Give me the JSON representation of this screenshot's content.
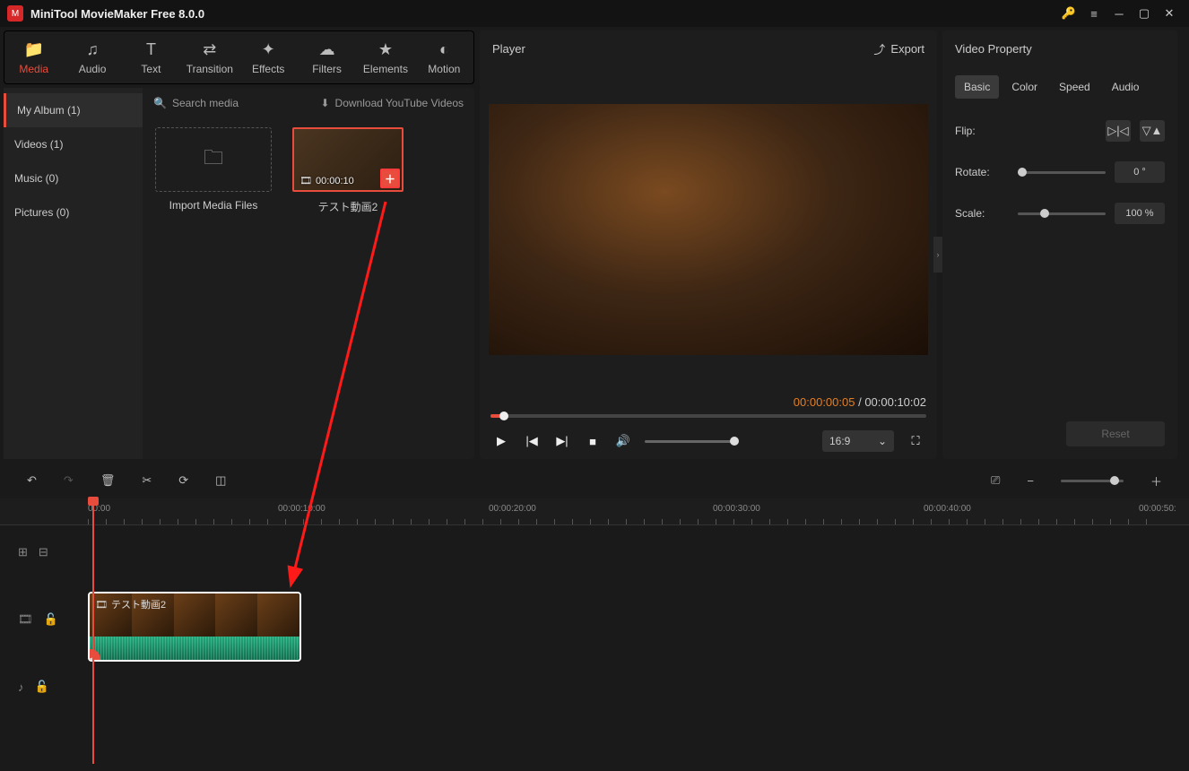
{
  "titlebar": {
    "app_title": "MiniTool MovieMaker Free 8.0.0"
  },
  "tabs": {
    "media": "Media",
    "audio": "Audio",
    "text": "Text",
    "transition": "Transition",
    "effects": "Effects",
    "filters": "Filters",
    "elements": "Elements",
    "motion": "Motion"
  },
  "media_side": {
    "my_album": "My Album (1)",
    "videos": "Videos (1)",
    "music": "Music (0)",
    "pictures": "Pictures (0)"
  },
  "media_tools": {
    "search_placeholder": "Search media",
    "download_label": "Download YouTube Videos"
  },
  "media_items": {
    "import_label": "Import Media Files",
    "clip1_duration": "00:00:10",
    "clip1_name": "テスト動画2"
  },
  "player": {
    "title": "Player",
    "export": "Export",
    "current_time": "00:00:00:05",
    "total_time": "00:00:10:02",
    "aspect": "16:9"
  },
  "property": {
    "title": "Video Property",
    "tab_basic": "Basic",
    "tab_color": "Color",
    "tab_speed": "Speed",
    "tab_audio": "Audio",
    "flip_label": "Flip:",
    "rotate_label": "Rotate:",
    "rotate_value": "0 °",
    "scale_label": "Scale:",
    "scale_value": "100 %",
    "reset": "Reset"
  },
  "timeline": {
    "t0": "00:00",
    "t10": "00:00:10:00",
    "t20": "00:00:20:00",
    "t30": "00:00:30:00",
    "t40": "00:00:40:00",
    "t50": "00:00:50:",
    "clip_name": "テスト動画2"
  }
}
